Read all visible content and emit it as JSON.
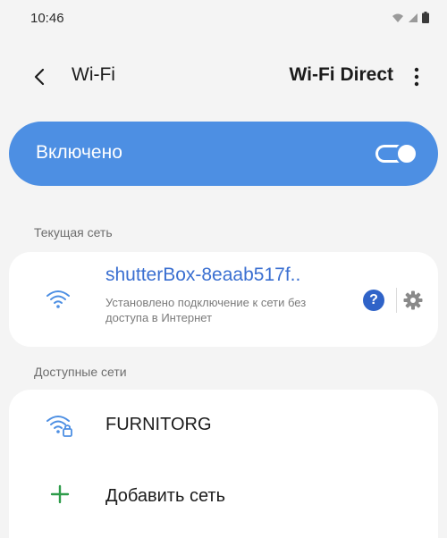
{
  "status_bar": {
    "time": "10:46"
  },
  "app_bar": {
    "title": "Wi-Fi",
    "wifi_direct": "Wi-Fi Direct"
  },
  "master_toggle": {
    "label": "Включено",
    "state": "on"
  },
  "current_section": {
    "header": "Текущая сеть",
    "network": {
      "name": "shutterBox-8eaab517f..",
      "status": "Установлено подключение к сети без доступа в Интернет"
    }
  },
  "available_section": {
    "header": "Доступные сети",
    "networks": [
      {
        "name": "FURNITORG",
        "secured": true
      }
    ],
    "add_network_label": "Добавить сеть"
  },
  "colors": {
    "accent": "#4d8fe3",
    "link": "#3a6fd1",
    "help": "#2f63c8",
    "add": "#2e9c4a",
    "background": "#f4f4f4",
    "card": "#ffffff"
  },
  "icons": {
    "back": "chevron-left-icon",
    "more": "more-vertical-icon",
    "wifi": "wifi-icon",
    "wifi_lock": "wifi-lock-icon",
    "help": "help-icon",
    "settings": "gear-icon",
    "add": "plus-icon"
  }
}
